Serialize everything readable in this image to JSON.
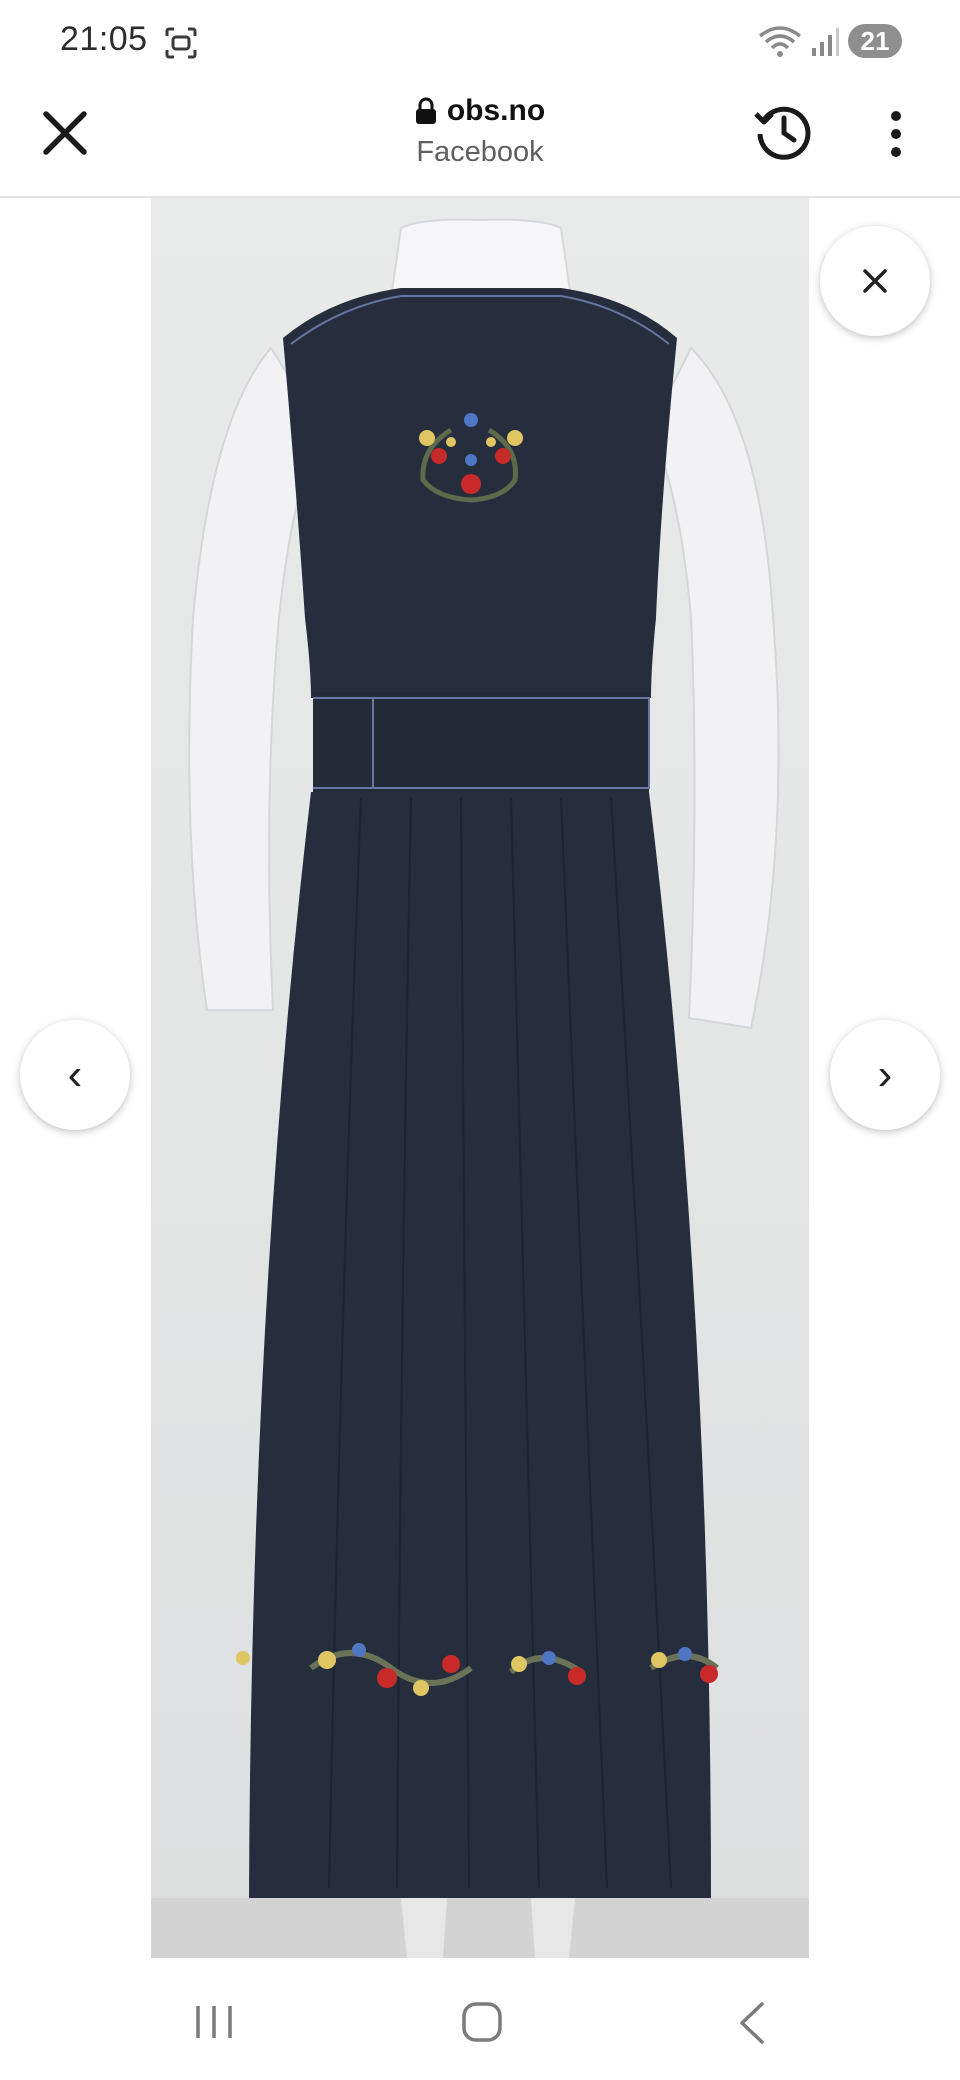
{
  "status_bar": {
    "time": "21:05",
    "battery_level": "21",
    "icons": [
      "screenshot-icon",
      "wifi-icon",
      "signal-icon"
    ]
  },
  "browser": {
    "domain": "obs.no",
    "source": "Facebook",
    "icons": [
      "close-icon",
      "lock-icon",
      "history-icon",
      "more-vert-icon"
    ]
  },
  "viewer": {
    "image_subject": "product-photo",
    "controls": [
      "dismiss-button",
      "previous-image-button",
      "next-image-button"
    ],
    "prev_glyph": "‹",
    "next_glyph": "›"
  },
  "navigation_bar": {
    "icons": [
      "recents-icon",
      "home-icon",
      "back-icon"
    ]
  },
  "colors": {
    "dress": "#262d3c",
    "blouse": "#f3f3f5",
    "backdrop": "#e5e7e6",
    "battery_badge": "#8f8f8f"
  }
}
